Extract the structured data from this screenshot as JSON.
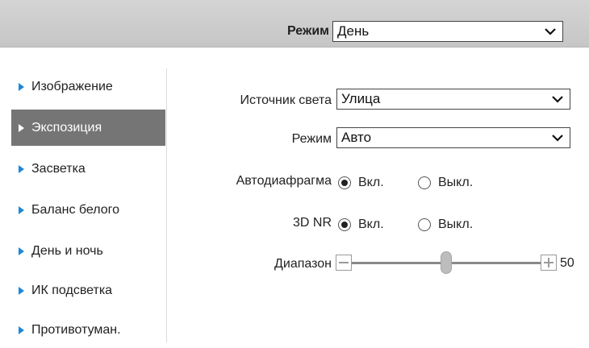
{
  "top": {
    "mode_label": "Режим",
    "mode_value": "День"
  },
  "sidebar": {
    "items": [
      {
        "label": "Изображение",
        "active": false
      },
      {
        "label": "Экспозиция",
        "active": true
      },
      {
        "label": "Засветка",
        "active": false
      },
      {
        "label": "Баланс белого",
        "active": false
      },
      {
        "label": "День и ночь",
        "active": false
      },
      {
        "label": "ИК подсветка",
        "active": false
      },
      {
        "label": "Противотуман.",
        "active": false
      }
    ]
  },
  "form": {
    "light_source_label": "Источник света",
    "light_source_value": "Улица",
    "mode_label": "Режим",
    "mode_value": "Авто",
    "iris_label": "Автодиафрагма",
    "iris_on": "Вкл.",
    "iris_off": "Выкл.",
    "nr_label": "3D NR",
    "nr_on": "Вкл.",
    "nr_off": "Выкл.",
    "range_label": "Диапазон",
    "range_value": "50",
    "range_min": 0,
    "range_max": 100
  },
  "colors": {
    "active_item_bg": "#757575",
    "accent_triangle": "#1e88d8"
  }
}
